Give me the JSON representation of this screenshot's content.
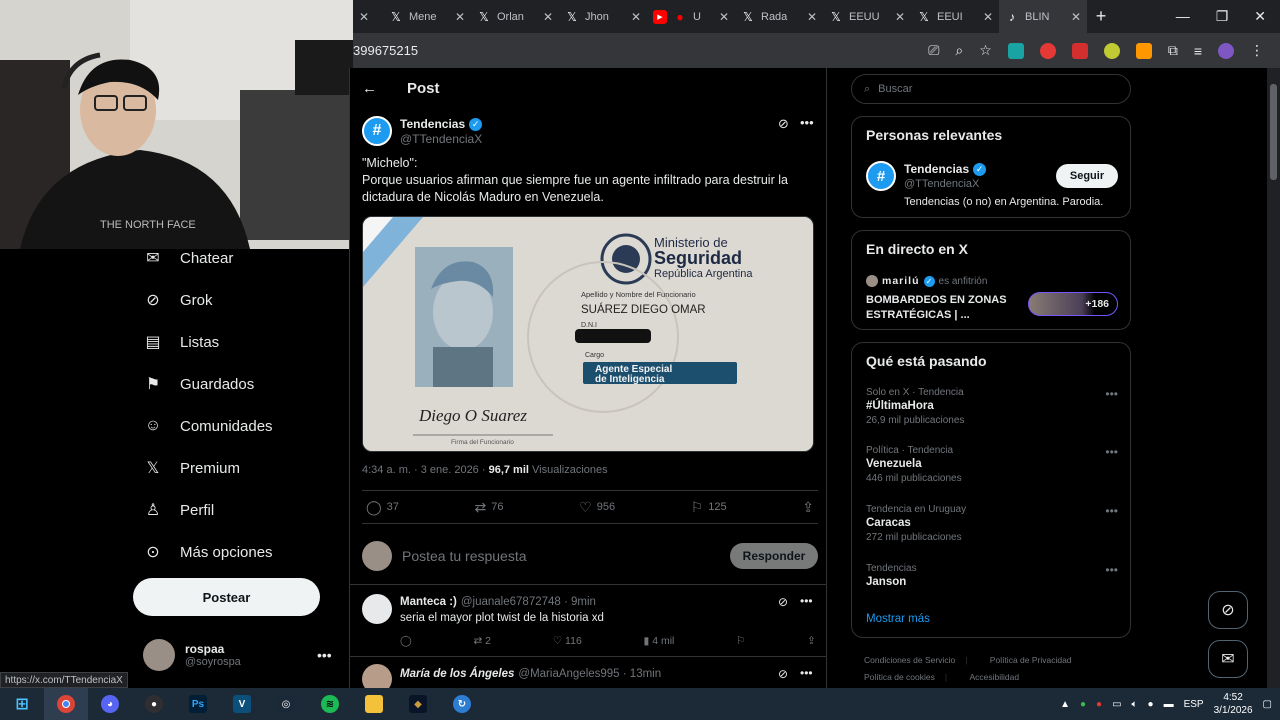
{
  "browser": {
    "tabs": [
      {
        "icon": "x-logo-icon",
        "label": ""
      },
      {
        "icon": "x-logo-icon",
        "label": "Mene"
      },
      {
        "icon": "x-logo-icon",
        "label": "Orlan"
      },
      {
        "icon": "x-logo-icon",
        "label": "Jhon"
      },
      {
        "icon": "youtube-icon",
        "label": "U"
      },
      {
        "icon": "x-logo-icon",
        "label": "Rada"
      },
      {
        "icon": "x-logo-icon",
        "label": "EEUU"
      },
      {
        "icon": "x-logo-icon",
        "label": "EEUI"
      },
      {
        "icon": "tiktok-icon",
        "label": "BLIN"
      }
    ],
    "url": "399675215",
    "status_url": "https://x.com/TTendenciaX"
  },
  "nav": {
    "items": [
      {
        "name": "chat",
        "icon": "mail-icon",
        "label": "Chatear"
      },
      {
        "name": "grok",
        "icon": "grok-icon",
        "label": "Grok"
      },
      {
        "name": "lists",
        "icon": "list-icon",
        "label": "Listas"
      },
      {
        "name": "bookmarks",
        "icon": "bookmark-icon",
        "label": "Guardados"
      },
      {
        "name": "communities",
        "icon": "people-icon",
        "label": "Comunidades"
      },
      {
        "name": "premium",
        "icon": "x-logo-icon",
        "label": "Premium"
      },
      {
        "name": "profile",
        "icon": "person-icon",
        "label": "Perfil"
      },
      {
        "name": "more",
        "icon": "more-circle-icon",
        "label": "Más opciones"
      }
    ],
    "post_label": "Postear",
    "account": {
      "name": "rospaa",
      "handle": "@soyrospa"
    }
  },
  "main": {
    "header_title": "Post",
    "tweet": {
      "author": "Tendencias",
      "handle": "@TTendenciaX",
      "text_line1": "\"Michelo\":",
      "text_line2": "Porque usuarios afirman que siempre fue un agente infiltrado para destruir la dictadura de Nicolás Maduro en Venezuela.",
      "card": {
        "ministry_line1": "Ministerio de",
        "ministry_line2": "Seguridad",
        "country": "República Argentina",
        "field_label": "Apellido y Nombre del Funcionario",
        "officer_name": "SUÁREZ DIEGO OMAR",
        "dni_label": "D.N.I",
        "rank_label": "Cargo",
        "rank_line1": "Agente Especial",
        "rank_line2": "de Inteligencia",
        "signature": "Diego O Suarez",
        "signature_label": "Firma del Funcionario"
      },
      "time": "4:34 a. m. · 3 ene. 2026 ·",
      "views_value": "96,7 mil",
      "views_label": "Visualizaciones",
      "replies": "37",
      "reposts": "76",
      "likes": "956",
      "bookmarks": "125"
    },
    "reply_placeholder": "Postea tu respuesta",
    "reply_button": "Responder",
    "replies": [
      {
        "name": "Manteca :)",
        "handle": "@juanale67872748 · 9min",
        "text": "seria el mayor plot twist de la historia xd",
        "reposts": "2",
        "likes": "116",
        "views": "4 mil"
      },
      {
        "name": "María de los Ángeles",
        "handle": "@MariaAngeles995 · 13min",
        "text": "",
        "reposts": "",
        "likes": "",
        "views": ""
      }
    ]
  },
  "sidebar": {
    "search_placeholder": "Buscar",
    "relevant": {
      "title": "Personas relevantes",
      "name": "Tendencias",
      "handle": "@TTendenciaX",
      "follow": "Seguir",
      "bio": "Tendencias (o no) en Argentina. Parodia."
    },
    "live": {
      "title": "En directo en X",
      "host_name": "marilú",
      "host_role": "es anfitrión",
      "headline": "BOMBARDEOS EN ZONAS ESTRATÉGICAS | ...",
      "listeners": "+186"
    },
    "trending": {
      "title": "Qué está pasando",
      "items": [
        {
          "category": "Solo en X · Tendencia",
          "name": "#ÚltimaHora",
          "count": "26,9 mil publicaciones"
        },
        {
          "category": "Política · Tendencia",
          "name": "Venezuela",
          "count": "446 mil publicaciones"
        },
        {
          "category": "Tendencia en Uruguay",
          "name": "Caracas",
          "count": "272 mil publicaciones"
        },
        {
          "category": "Tendencias",
          "name": "Janson",
          "count": ""
        }
      ],
      "show_more": "Mostrar más"
    },
    "footer": [
      "Condiciones de Servicio",
      "Política de Privacidad",
      "Política de cookies",
      "Accesibilidad"
    ]
  },
  "taskbar": {
    "apps": [
      {
        "name": "windows-start",
        "color": "#0078d4",
        "glyph": "⊞"
      },
      {
        "name": "chrome",
        "color": "#db4437",
        "glyph": "◉"
      },
      {
        "name": "discord",
        "color": "#5865f2",
        "glyph": "◐"
      },
      {
        "name": "obs",
        "color": "#302e31",
        "glyph": "●"
      },
      {
        "name": "photoshop",
        "color": "#001e36",
        "glyph": "Ps"
      },
      {
        "name": "vegas",
        "color": "#0b4f7a",
        "glyph": "V"
      },
      {
        "name": "steam",
        "color": "#1b2838",
        "glyph": "◎"
      },
      {
        "name": "spotify",
        "color": "#1db954",
        "glyph": "≋"
      },
      {
        "name": "file-explorer",
        "color": "#f3c13a",
        "glyph": "▭"
      },
      {
        "name": "league",
        "color": "#0a1428",
        "glyph": "◆"
      },
      {
        "name": "launcher",
        "color": "#2d7dd2",
        "glyph": "↻"
      }
    ],
    "lang": "ESP",
    "time": "4:52",
    "date": "3/1/2026"
  },
  "colors": {
    "accent": "#1d9bf0",
    "background": "#000000",
    "border": "#2f3336",
    "muted": "#71767b"
  }
}
